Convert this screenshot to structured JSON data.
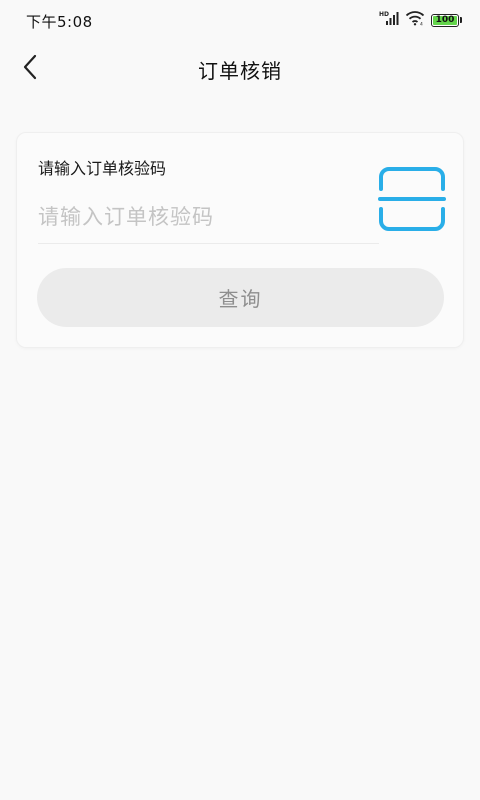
{
  "status_bar": {
    "time": "下午5:08",
    "battery_level": "100",
    "icons": [
      "hd-signal-icon",
      "wifi-icon",
      "battery-icon"
    ]
  },
  "header": {
    "back_icon": "chevron-left-icon",
    "title": "订单核销"
  },
  "form": {
    "label": "请输入订单核验码",
    "input_value": "",
    "input_placeholder": "请输入订单核验码",
    "scan_icon": "scan-code-icon",
    "submit_label": "查询"
  },
  "colors": {
    "background": "#f9f9f9",
    "accent": "#29aee8",
    "button_bg": "#ebebeb",
    "button_text": "#8e8e8e",
    "placeholder": "#c4c4c4",
    "battery_fill": "#63d44b"
  }
}
